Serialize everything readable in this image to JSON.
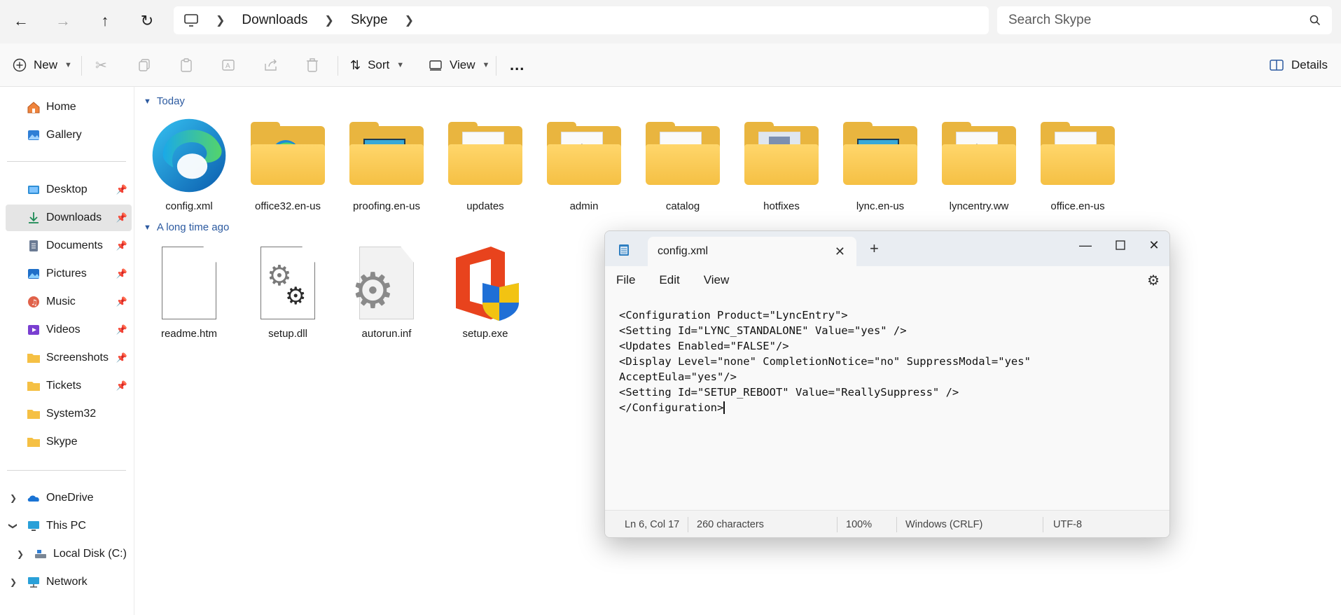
{
  "address": {
    "breadcrumb": [
      "Downloads",
      "Skype"
    ],
    "search_placeholder": "Search Skype"
  },
  "toolbar": {
    "new_label": "New",
    "sort_label": "Sort",
    "view_label": "View",
    "more_label": "...",
    "details_label": "Details"
  },
  "sidebar": {
    "quick": [
      {
        "label": "Home",
        "icon": "home-icon"
      },
      {
        "label": "Gallery",
        "icon": "gallery-icon"
      }
    ],
    "pinned": [
      {
        "label": "Desktop",
        "icon": "desktop-folder-icon",
        "pinned": true
      },
      {
        "label": "Downloads",
        "icon": "download-icon",
        "pinned": true,
        "active": true
      },
      {
        "label": "Documents",
        "icon": "documents-icon",
        "pinned": true
      },
      {
        "label": "Pictures",
        "icon": "pictures-icon",
        "pinned": true
      },
      {
        "label": "Music",
        "icon": "music-icon",
        "pinned": true
      },
      {
        "label": "Videos",
        "icon": "videos-icon",
        "pinned": true
      },
      {
        "label": "Screenshots",
        "icon": "folder-icon",
        "pinned": true
      },
      {
        "label": "Tickets",
        "icon": "folder-icon",
        "pinned": true
      },
      {
        "label": "System32",
        "icon": "folder-icon",
        "pinned": false
      },
      {
        "label": "Skype",
        "icon": "folder-icon",
        "pinned": false
      }
    ],
    "tree": [
      {
        "label": "OneDrive",
        "icon": "onedrive-icon"
      },
      {
        "label": "This PC",
        "icon": "pc-icon"
      },
      {
        "label": "Local Disk (C:)",
        "icon": "disk-icon"
      },
      {
        "label": "Network",
        "icon": "network-icon"
      }
    ]
  },
  "content": {
    "group_today": "Today",
    "group_old": "A long time ago",
    "today_items": [
      {
        "name": "config.xml",
        "kind": "edge"
      },
      {
        "name": "office32.en-us",
        "kind": "folder-edge"
      },
      {
        "name": "proofing.en-us",
        "kind": "folder-screen"
      },
      {
        "name": "updates",
        "kind": "folder-doc"
      },
      {
        "name": "admin",
        "kind": "folder-gear"
      },
      {
        "name": "catalog",
        "kind": "folder-cd"
      },
      {
        "name": "hotfixes",
        "kind": "folder-box"
      },
      {
        "name": "lync.en-us",
        "kind": "folder-screen"
      },
      {
        "name": "lyncentry.ww",
        "kind": "folder-gear"
      },
      {
        "name": "office.en-us",
        "kind": "folder-doc"
      }
    ],
    "old_items": [
      {
        "name": "readme.htm",
        "kind": "doc"
      },
      {
        "name": "setup.dll",
        "kind": "doc-gear"
      },
      {
        "name": "autorun.inf",
        "kind": "doc-bigGear"
      },
      {
        "name": "setup.exe",
        "kind": "office"
      }
    ]
  },
  "notepad": {
    "tab_title": "config.xml",
    "menu": [
      "File",
      "Edit",
      "View"
    ],
    "lines": [
      "<Configuration Product=\"LyncEntry\">",
      "<Setting Id=\"LYNC_STANDALONE\" Value=\"yes\" />",
      "<Updates Enabled=\"FALSE\"/>",
      "<Display Level=\"none\" CompletionNotice=\"no\" SuppressModal=\"yes\"",
      "AcceptEula=\"yes\"/>",
      "<Setting Id=\"SETUP_REBOOT\" Value=\"ReallySuppress\" />",
      "</Configuration>"
    ],
    "status": {
      "position": "Ln 6, Col 17",
      "chars": "260 characters",
      "zoom": "100%",
      "line_ending": "Windows (CRLF)",
      "encoding": "UTF-8"
    }
  },
  "colors": {
    "accent": "#2c5aa0",
    "folder": "#f5c044",
    "office_red": "#e8431d"
  }
}
